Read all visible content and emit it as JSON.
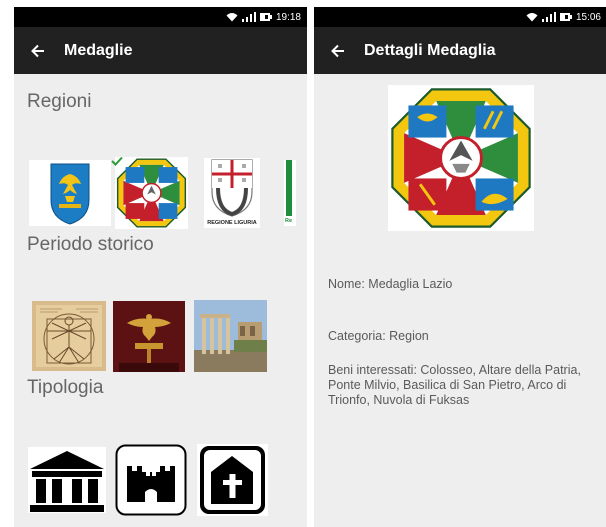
{
  "left_screen": {
    "status": {
      "time": "19:18"
    },
    "appbar": {
      "title": "Medaglie"
    },
    "sections": [
      {
        "title": "Regioni"
      },
      {
        "title": "Periodo storico"
      },
      {
        "title": "Tipologia"
      }
    ],
    "region_badges": {
      "liguria_caption": "REGIONE LIGURIA",
      "partial_caption": "Re"
    }
  },
  "right_screen": {
    "status": {
      "time": "15:06"
    },
    "appbar": {
      "title": "Dettagli Medaglia"
    },
    "details": {
      "name": "Nome: Medaglia Lazio",
      "category": "Categoria: Region",
      "assets": "Beni interessati: Colosseo, Altare della Patria, Ponte Milvio, Basilica di San Pietro, Arco di Trionfo, Nuvola di Fuksas"
    }
  },
  "colors": {
    "statusbar": "#000000",
    "appbar": "#212121",
    "background": "#eeeeee",
    "section_text": "#666666"
  },
  "icons": [
    "wifi-icon",
    "signal-icon",
    "battery-icon",
    "back-arrow-icon",
    "friuli-coat-of-arms",
    "lazio-coat-of-arms",
    "liguria-coat-of-arms",
    "vitruvian-man-image",
    "roman-eagle-image",
    "roman-forum-image",
    "museum-icon",
    "castle-icon",
    "church-icon",
    "checkmark-icon"
  ]
}
